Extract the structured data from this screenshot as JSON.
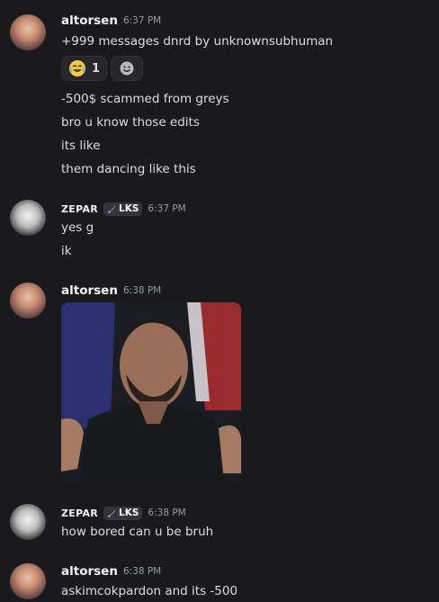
{
  "messages": [
    {
      "author": "altorsen",
      "timestamp": "6:37 PM",
      "lines": [
        "+999 messages dnrd by unknownsubhuman"
      ],
      "reactions": [
        {
          "emoji_icon": "joy-emoji-icon",
          "count": "1"
        },
        {
          "emoji_icon": "add-reaction-icon",
          "count": ""
        }
      ],
      "extra_lines": [
        "-500$ scammed from greys",
        "bro u know those edits",
        "its like",
        "them dancing like this"
      ]
    },
    {
      "author": "ZEPAR",
      "tag": "LKS",
      "timestamp": "6:37 PM",
      "lines": [
        "yes g",
        "ik"
      ]
    },
    {
      "author": "altorsen",
      "timestamp": "6:38 PM",
      "attachment": "gif-image"
    },
    {
      "author": "ZEPAR",
      "tag": "LKS",
      "timestamp": "6:38 PM",
      "lines": [
        "how bored can u be bruh"
      ]
    },
    {
      "author": "altorsen",
      "timestamp": "6:38 PM",
      "lines": [
        "askimcokpardon and its -500"
      ]
    }
  ],
  "colors": {
    "background": "#1a1a1e",
    "username": "#f2f3f5",
    "timestamp": "#949ba4",
    "text": "#dbdee1",
    "tag_background": "#34343c"
  }
}
